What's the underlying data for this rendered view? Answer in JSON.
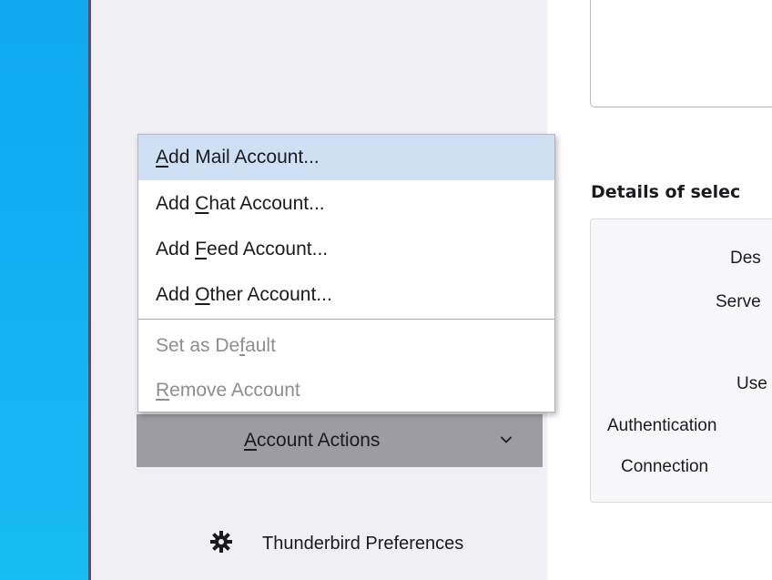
{
  "menu": {
    "items": [
      {
        "pre": "",
        "u": "A",
        "post": "dd Mail Account...",
        "state": "hover"
      },
      {
        "pre": "Add ",
        "u": "C",
        "post": "hat Account...",
        "state": "normal"
      },
      {
        "pre": "Add ",
        "u": "F",
        "post": "eed Account...",
        "state": "normal"
      },
      {
        "pre": "Add ",
        "u": "O",
        "post": "ther Account...",
        "state": "normal"
      },
      {
        "pre": "Set as De",
        "u": "f",
        "post": "ault",
        "state": "disabled"
      },
      {
        "pre": "",
        "u": "R",
        "post": "emove Account",
        "state": "disabled"
      }
    ]
  },
  "account_actions": {
    "pre": "",
    "u": "A",
    "post": "ccount Actions",
    "icon": "chevron-down-icon"
  },
  "preferences": {
    "label": "Thunderbird Preferences",
    "icon": "gear-icon"
  },
  "details": {
    "title": "Details of selec",
    "labels": [
      "Des",
      "Serve",
      "Use",
      "Authentication",
      "Connection"
    ]
  },
  "colors": {
    "menu_hover": "#cfe0f4",
    "account_actions_bg": "#9c9ca2",
    "sidebar_bg": "#f0f0f4",
    "desktop": "#12b3f3"
  }
}
